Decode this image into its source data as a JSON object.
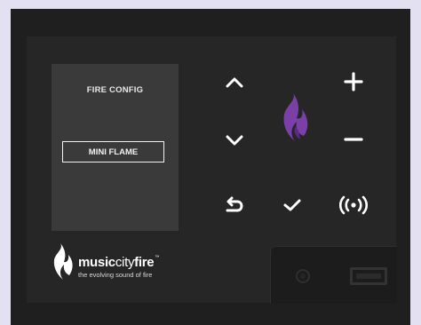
{
  "screen": {
    "title": "FIRE CONFIG",
    "selected_option": "MINI FLAME"
  },
  "controls": {
    "up": "chevron-up-icon",
    "down": "chevron-down-icon",
    "plus": "plus-icon",
    "minus": "minus-icon",
    "back": "return-arrow-icon",
    "confirm": "checkmark-icon",
    "wireless": "wireless-broadcast-icon"
  },
  "brand": {
    "name_part1": "music",
    "name_part2": "city",
    "name_part3": "fire",
    "trademark": "™",
    "tagline": "the evolving sound of fire"
  },
  "colors": {
    "background": "#e3e1f1",
    "device_body": "#1f1f1f",
    "faceplate": "#262626",
    "screen": "#3a3a3a",
    "flame_purple": "#7b3fa8",
    "icon_white": "#ffffff"
  }
}
